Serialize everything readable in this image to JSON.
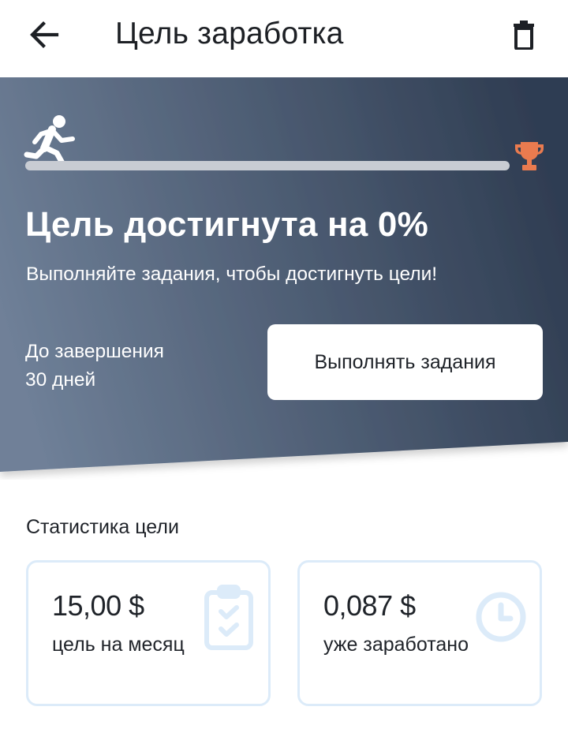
{
  "header": {
    "title": "Цель заработка",
    "back_icon": "arrow-left-icon",
    "delete_icon": "trash-icon"
  },
  "hero": {
    "runner_icon": "running-person-icon",
    "trophy_icon": "trophy-icon",
    "progress_fraction": 0,
    "title": "Цель достигнута на 0%",
    "subtitle": "Выполняйте задания, чтобы достигнуть цели!",
    "deadline_label": "До завершения",
    "deadline_value": "30 дней",
    "cta_label": "Выполнять задания",
    "gradient_start": "#6f8098",
    "gradient_end": "#2f3d52",
    "trophy_color": "#ea7b4f"
  },
  "stats": {
    "title": "Статистика цели",
    "cards": [
      {
        "value": "15,00 $",
        "label": "цель на месяц",
        "icon": "clipboard-check-icon"
      },
      {
        "value": "0,087 $",
        "label": "уже заработано",
        "icon": "clock-icon"
      }
    ],
    "border_color": "#dcebf9",
    "icon_color": "#dcebf9"
  }
}
